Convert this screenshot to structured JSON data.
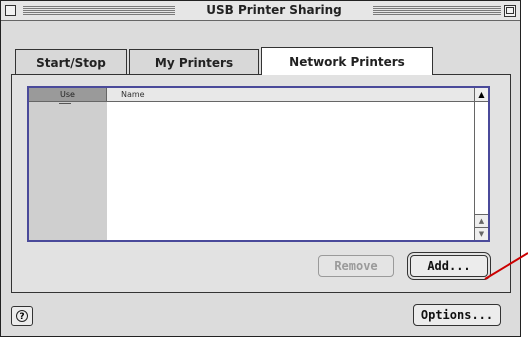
{
  "window": {
    "title": "USB Printer Sharing"
  },
  "tabs": [
    {
      "label": "Start/Stop",
      "active": false
    },
    {
      "label": "My Printers",
      "active": false
    },
    {
      "label": "Network Printers",
      "active": true
    }
  ],
  "list": {
    "columns": [
      {
        "label": "Use"
      },
      {
        "label": "Name"
      }
    ],
    "rows": []
  },
  "buttons": {
    "remove": "Remove",
    "add": "Add...",
    "options": "Options..."
  },
  "icons": {
    "help": "help-icon",
    "close": "close-box-icon",
    "zoom": "zoom-box-icon"
  },
  "colors": {
    "list_border": "#4a4a9a",
    "annotation_pointer": "#cc0000"
  }
}
